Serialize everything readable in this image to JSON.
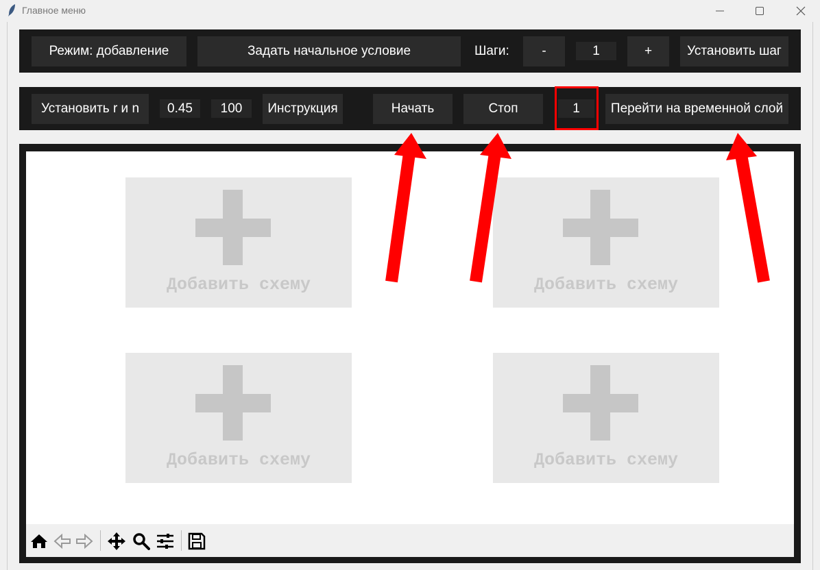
{
  "window": {
    "title": "Главное меню",
    "controls": {
      "minimize_icon": "minimize-icon",
      "maximize_icon": "maximize-icon",
      "close_icon": "close-icon"
    }
  },
  "top_bar": {
    "mode_button": "Режим: добавление",
    "initial_condition_button": "Задать начальное условие",
    "steps_label": "Шаги:",
    "minus_button": "-",
    "steps_value": "1",
    "plus_button": "+",
    "set_step_button": "Установить шаг"
  },
  "second_bar": {
    "set_r_n_button": "Установить r и n",
    "r_value": "0.45",
    "n_value": "100",
    "instruction_button": "Инструкция",
    "start_button": "Начать",
    "stop_button": "Стоп",
    "layer_value": "1",
    "go_to_layer_button": "Перейти на временной слой"
  },
  "plot": {
    "schemes": [
      {
        "label": "Добавить схему"
      },
      {
        "label": "Добавить схему"
      },
      {
        "label": "Добавить схему"
      },
      {
        "label": "Добавить схему"
      }
    ]
  },
  "toolbar": {
    "icons": [
      "home-icon",
      "back-icon",
      "forward-icon",
      "pan-icon",
      "zoom-icon",
      "configure-subplots-icon",
      "save-icon"
    ]
  },
  "colors": {
    "bar_background": "#1a1a1a",
    "button_background": "#2b2b2b",
    "annotation_red": "#ff0000",
    "placeholder_gray": "#e8e8e8"
  }
}
